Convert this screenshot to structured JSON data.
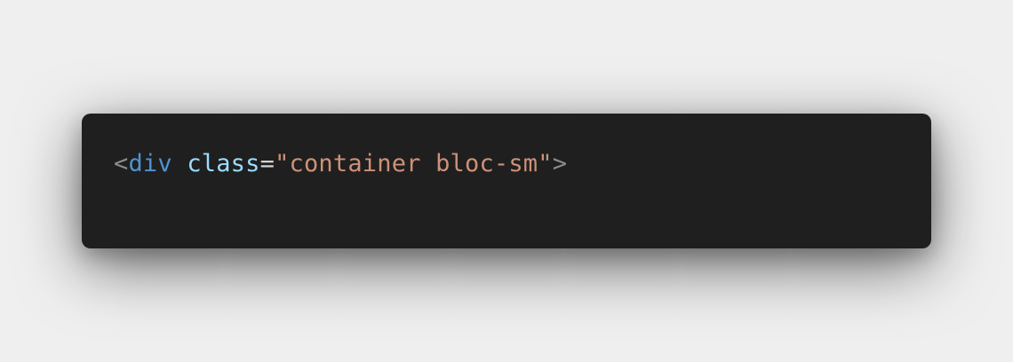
{
  "code": {
    "open_bracket": "<",
    "tag": "div",
    "space": " ",
    "attr_name": "class",
    "equals": "=",
    "attr_value": "\"container bloc-sm\"",
    "close_bracket": ">"
  },
  "colors": {
    "page_background": "#efefef",
    "card_background": "#1f1f1f",
    "punctuation": "#8c8c8c",
    "tag": "#4e93d1",
    "attribute": "#9cdcfe",
    "equals": "#d4d4d4",
    "string": "#ce9178"
  }
}
